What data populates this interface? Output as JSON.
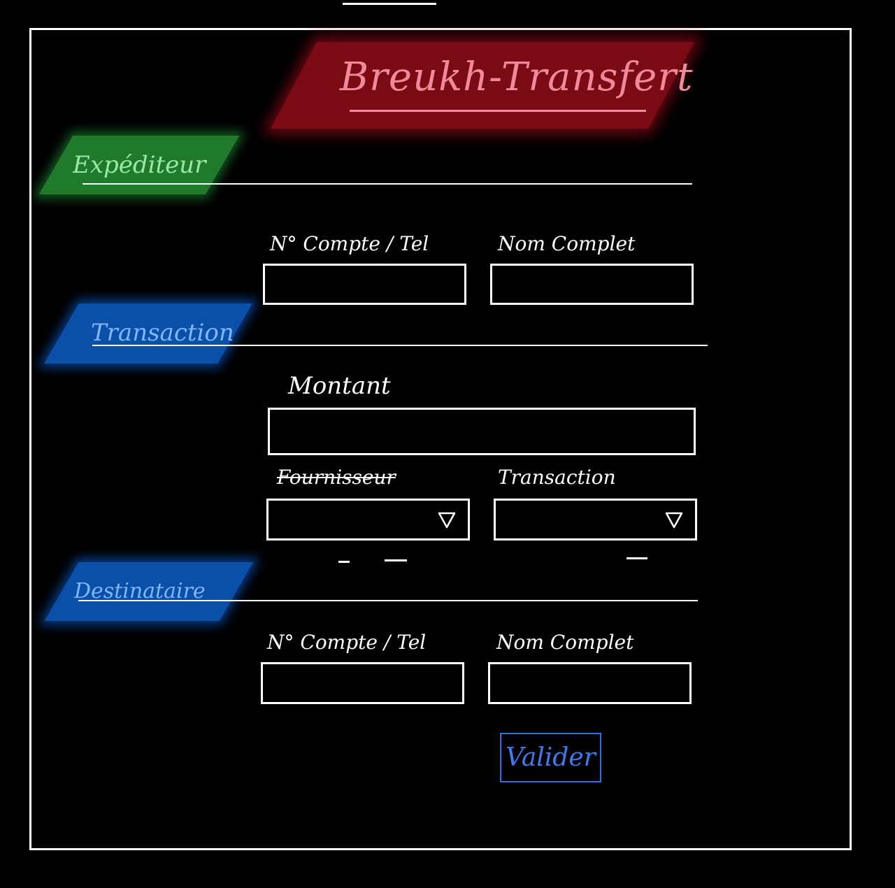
{
  "app": {
    "title": "Breukh-Transfert"
  },
  "colors": {
    "background": "#000000",
    "title_banner": "#7a0a14",
    "title_text": "#f08a9a",
    "expediteur_tag": "#1f7a2c",
    "expediteur_text": "#9be7a6",
    "section_tag_blue": "#0a4fa8",
    "section_text_blue": "#7fb6ff",
    "button_border": "#2f6fe0",
    "button_text": "#3d7bef"
  },
  "expediteur": {
    "label": "Expéditeur",
    "account_label": "N° Compte / Tel",
    "account_value": "",
    "name_label": "Nom Complet",
    "name_value": ""
  },
  "transaction": {
    "label": "Transaction",
    "amount_label": "Montant",
    "amount_value": "",
    "provider_label": "Fournisseur",
    "provider_selected": "",
    "type_label": "Transaction",
    "type_selected": "",
    "dropdown_icon": "triangle-down-icon"
  },
  "destinataire": {
    "label": "Destinataire",
    "account_label": "N° Compte / Tel",
    "account_value": "",
    "name_label": "Nom Complet",
    "name_value": ""
  },
  "actions": {
    "submit_label": "Valider"
  }
}
